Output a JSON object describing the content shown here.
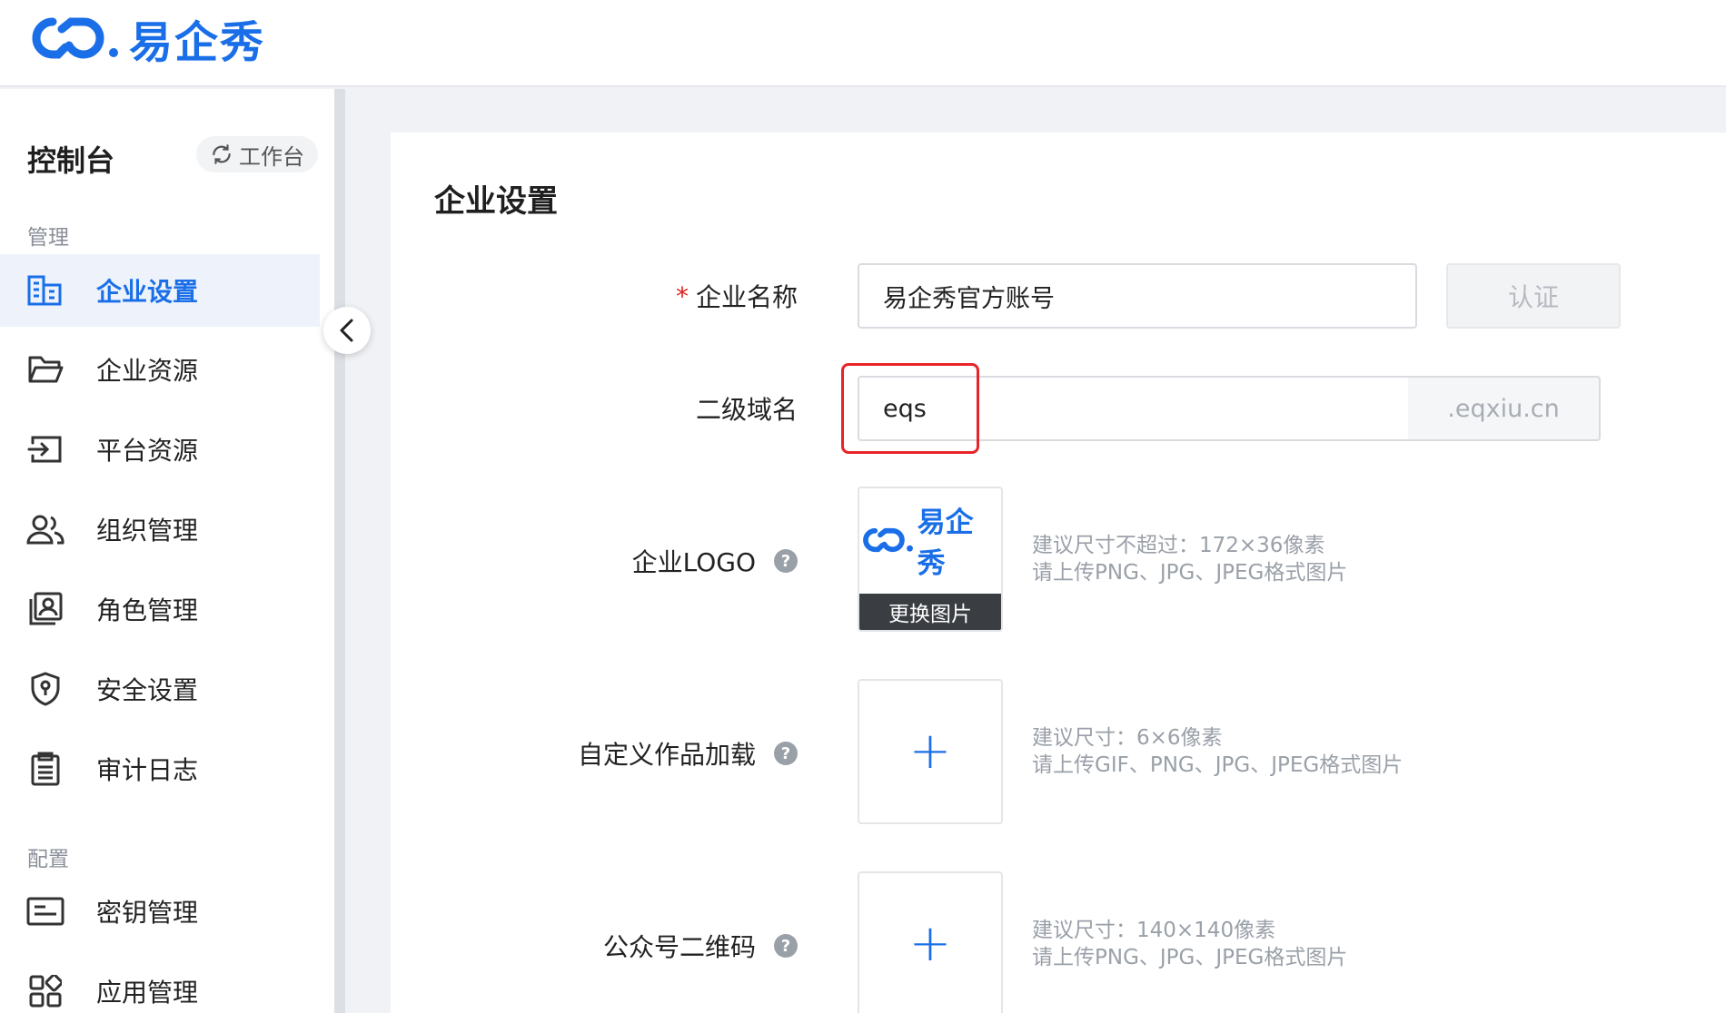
{
  "brand": {
    "name": "易企秀",
    "color": "#1a6fe8"
  },
  "sidebar": {
    "title": "控制台",
    "workbench_label": "工作台",
    "groups": [
      {
        "label": "管理"
      },
      {
        "label": "配置"
      }
    ],
    "items": [
      {
        "label": "企业设置",
        "icon": "building-icon",
        "active": true
      },
      {
        "label": "企业资源",
        "icon": "folder-icon"
      },
      {
        "label": "平台资源",
        "icon": "import-icon"
      },
      {
        "label": "组织管理",
        "icon": "users-icon"
      },
      {
        "label": "角色管理",
        "icon": "role-icon"
      },
      {
        "label": "安全设置",
        "icon": "shield-icon"
      },
      {
        "label": "审计日志",
        "icon": "clipboard-icon"
      },
      {
        "label": "密钥管理",
        "icon": "key-card-icon"
      },
      {
        "label": "应用管理",
        "icon": "apps-icon"
      }
    ]
  },
  "page": {
    "title": "企业设置",
    "fields": {
      "company_name": {
        "label": "企业名称",
        "required_mark": "*",
        "value": "易企秀官方账号",
        "action_label": "认证"
      },
      "subdomain": {
        "label": "二级域名",
        "value": "eqs",
        "suffix": ".eqxiu.cn"
      },
      "logo": {
        "label": "企业LOGO",
        "help": "?",
        "preview_text": "易企秀",
        "replace_label": "更换图片",
        "hint_lines": [
          "建议尺寸不超过：172×36像素",
          "请上传PNG、JPG、JPEG格式图片"
        ]
      },
      "loading": {
        "label": "自定义作品加载",
        "help": "?",
        "upload_symbol": "+",
        "hint_lines": [
          "建议尺寸：6×6像素",
          "请上传GIF、PNG、JPG、JPEG格式图片"
        ]
      },
      "qrcode": {
        "label": "公众号二维码",
        "help": "?",
        "upload_symbol": "+",
        "hint_lines": [
          "建议尺寸：140×140像素",
          "请上传PNG、JPG、JPEG格式图片"
        ]
      }
    }
  },
  "colors": {
    "accent": "#1a6fe8",
    "required": "#e02020",
    "highlight": "#e8242a"
  }
}
